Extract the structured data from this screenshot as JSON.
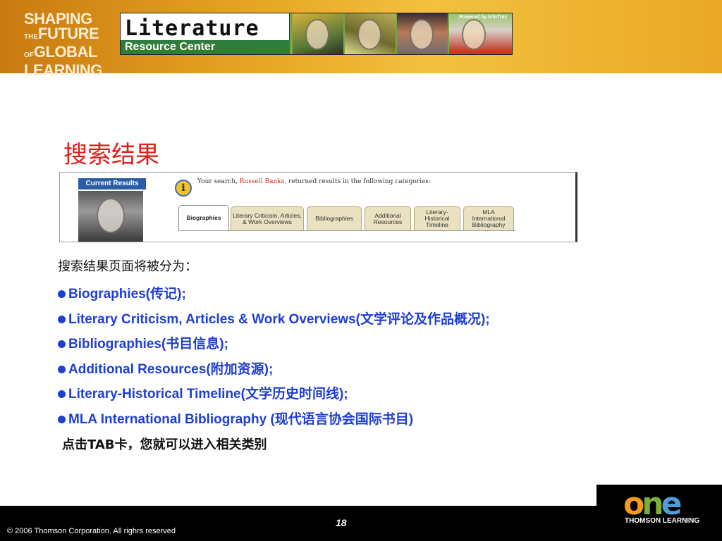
{
  "header": {
    "brand_lines": [
      "SHAPING",
      "THE",
      "FUTURE",
      "OF",
      "GLOBAL",
      "LEARNING"
    ],
    "banner_title": "Literature",
    "banner_subtitle": "Resource Center",
    "banner_powered": "Powered by InfoTrac",
    "colors": {
      "band": "#e7a524",
      "banner_green": "#2f7d3a"
    }
  },
  "slide": {
    "title": "搜索结果",
    "title_color": "#e0201a"
  },
  "screenshot": {
    "badge": "Current Results",
    "message_prefix": "Your search, ",
    "message_name": "Russell Banks,",
    "message_suffix": " returned results in the following categories:",
    "info_icon": "info-icon",
    "tabs": [
      {
        "label": "Biographies",
        "active": true
      },
      {
        "label": "Literary Criticism, Articles, & Work Overviews",
        "active": false
      },
      {
        "label": "Bibliographies",
        "active": false
      },
      {
        "label": "Additional Resources",
        "active": false
      },
      {
        "label": "Literary-Historical Timeline",
        "active": false
      },
      {
        "label": "MLA International Bibliography",
        "active": false
      }
    ]
  },
  "body": {
    "intro": "搜索结果页面将被分为：",
    "bullets": [
      "Biographies(传记);",
      "Literary Criticism, Articles & Work Overviews(文学评论及作品概况);",
      "Bibliographies(书目信息);",
      "Additional Resources(附加资源);",
      "Literary-Historical Timeline(文学历史时间线);",
      "MLA International Bibliography (现代语言协会国际书目)"
    ],
    "bullet_color": "#1f3fcf",
    "tip": "点击TAB卡，您就可以进入相关类别"
  },
  "footer": {
    "copyright": "© 2006 Thomson Corporation. All righrs reserved",
    "page_number": "18",
    "logo_word": "one",
    "logo_sub": "THOMSON LEARNING"
  }
}
